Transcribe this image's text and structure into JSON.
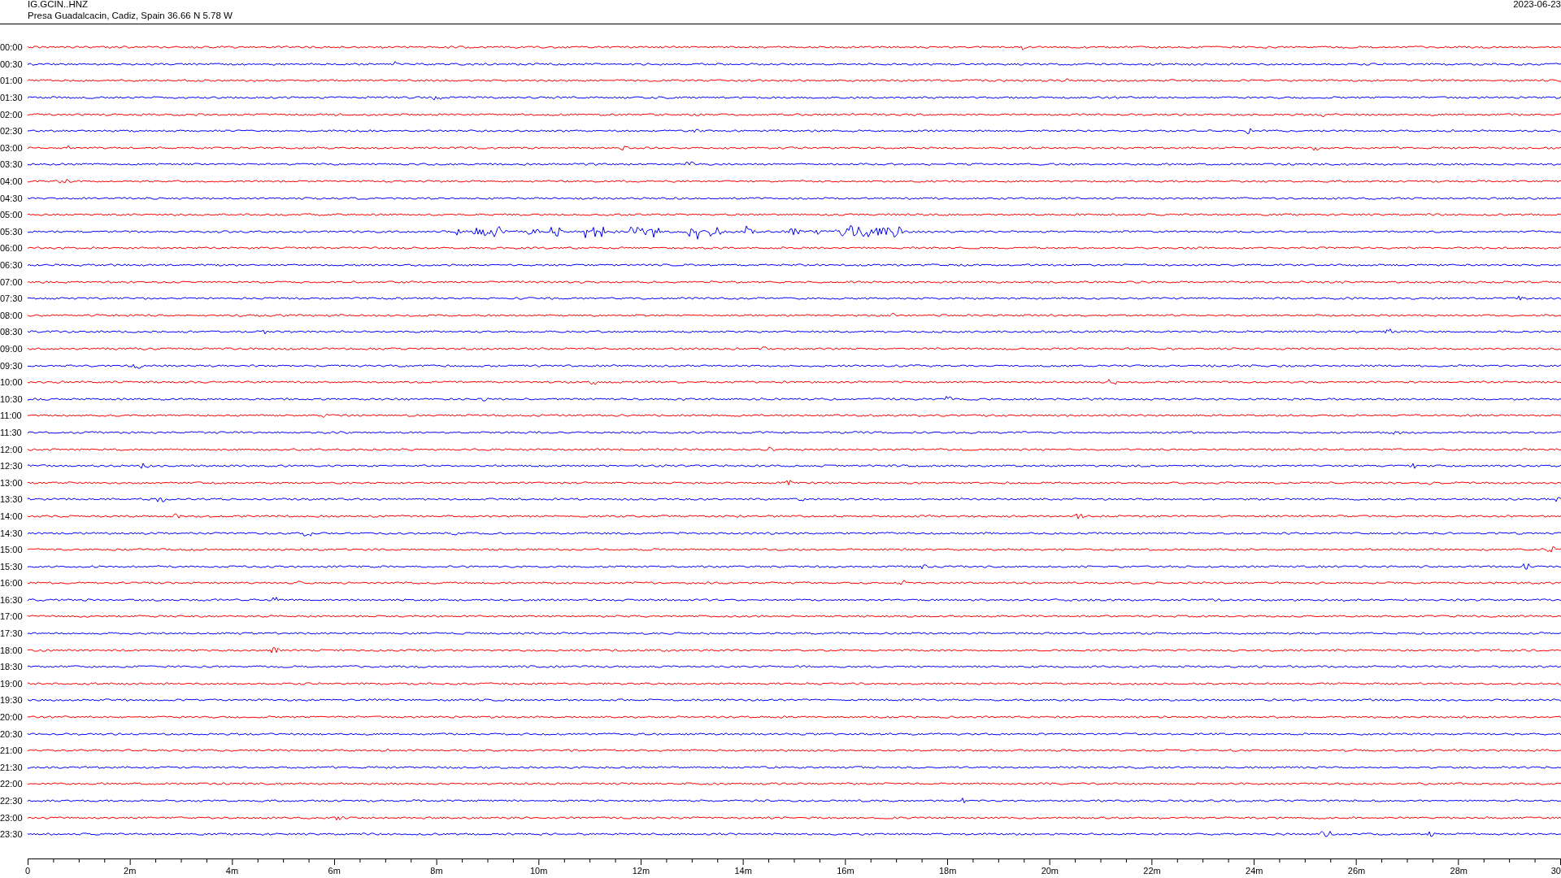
{
  "header": {
    "station": "IG.GCIN..HNZ",
    "location": "Presa Guadalcacin, Cadiz, Spain  36.66 N 5.78 W",
    "date": "2023-06-23"
  },
  "traces": [
    {
      "time": "00:00",
      "color": "#ff0000",
      "kind": "quiet"
    },
    {
      "time": "00:30",
      "color": "#0000ff",
      "kind": "quiet"
    },
    {
      "time": "01:00",
      "color": "#ff0000",
      "kind": "quiet"
    },
    {
      "time": "01:30",
      "color": "#0000ff",
      "kind": "quiet"
    },
    {
      "time": "02:00",
      "color": "#ff0000",
      "kind": "quiet"
    },
    {
      "time": "02:30",
      "color": "#0000ff",
      "kind": "quiet"
    },
    {
      "time": "03:00",
      "color": "#ff0000",
      "kind": "quiet"
    },
    {
      "time": "03:30",
      "color": "#0000ff",
      "kind": "quiet"
    },
    {
      "time": "04:00",
      "color": "#ff0000",
      "kind": "quiet"
    },
    {
      "time": "04:30",
      "color": "#0000ff",
      "kind": "quiet"
    },
    {
      "time": "05:00",
      "color": "#ff0000",
      "kind": "quiet"
    },
    {
      "time": "05:30",
      "color": "#0000ff",
      "kind": "event"
    },
    {
      "time": "06:00",
      "color": "#ff0000",
      "kind": "quiet"
    },
    {
      "time": "06:30",
      "color": "#0000ff",
      "kind": "quiet"
    },
    {
      "time": "07:00",
      "color": "#ff0000",
      "kind": "quiet"
    },
    {
      "time": "07:30",
      "color": "#0000ff",
      "kind": "quiet"
    },
    {
      "time": "08:00",
      "color": "#ff0000",
      "kind": "quiet"
    },
    {
      "time": "08:30",
      "color": "#0000ff",
      "kind": "quiet"
    },
    {
      "time": "09:00",
      "color": "#ff0000",
      "kind": "quiet"
    },
    {
      "time": "09:30",
      "color": "#0000ff",
      "kind": "quiet"
    },
    {
      "time": "10:00",
      "color": "#ff0000",
      "kind": "quiet"
    },
    {
      "time": "10:30",
      "color": "#0000ff",
      "kind": "quiet"
    },
    {
      "time": "11:00",
      "color": "#ff0000",
      "kind": "quiet"
    },
    {
      "time": "11:30",
      "color": "#0000ff",
      "kind": "quiet"
    },
    {
      "time": "12:00",
      "color": "#ff0000",
      "kind": "quiet"
    },
    {
      "time": "12:30",
      "color": "#0000ff",
      "kind": "quiet"
    },
    {
      "time": "13:00",
      "color": "#ff0000",
      "kind": "quiet"
    },
    {
      "time": "13:30",
      "color": "#0000ff",
      "kind": "quiet"
    },
    {
      "time": "14:00",
      "color": "#ff0000",
      "kind": "quiet"
    },
    {
      "time": "14:30",
      "color": "#0000ff",
      "kind": "quiet"
    },
    {
      "time": "15:00",
      "color": "#ff0000",
      "kind": "quiet"
    },
    {
      "time": "15:30",
      "color": "#0000ff",
      "kind": "quiet"
    },
    {
      "time": "16:00",
      "color": "#ff0000",
      "kind": "quiet"
    },
    {
      "time": "16:30",
      "color": "#0000ff",
      "kind": "quiet"
    },
    {
      "time": "17:00",
      "color": "#ff0000",
      "kind": "quiet"
    },
    {
      "time": "17:30",
      "color": "#0000ff",
      "kind": "quiet"
    },
    {
      "time": "18:00",
      "color": "#ff0000",
      "kind": "quiet"
    },
    {
      "time": "18:30",
      "color": "#0000ff",
      "kind": "quiet"
    },
    {
      "time": "19:00",
      "color": "#ff0000",
      "kind": "quiet"
    },
    {
      "time": "19:30",
      "color": "#0000ff",
      "kind": "quiet"
    },
    {
      "time": "20:00",
      "color": "#ff0000",
      "kind": "quiet"
    },
    {
      "time": "20:30",
      "color": "#0000ff",
      "kind": "quiet"
    },
    {
      "time": "21:00",
      "color": "#ff0000",
      "kind": "quiet"
    },
    {
      "time": "21:30",
      "color": "#0000ff",
      "kind": "quiet"
    },
    {
      "time": "22:00",
      "color": "#ff0000",
      "kind": "quiet"
    },
    {
      "time": "22:30",
      "color": "#0000ff",
      "kind": "quiet"
    },
    {
      "time": "23:00",
      "color": "#ff0000",
      "kind": "quiet"
    },
    {
      "time": "23:30",
      "color": "#0000ff",
      "kind": "quiet"
    }
  ],
  "axis": {
    "labels": [
      "0",
      "2m",
      "4m",
      "6m",
      "8m",
      "10m",
      "12m",
      "14m",
      "16m",
      "18m",
      "20m",
      "22m",
      "24m",
      "26m",
      "28m",
      "30"
    ]
  }
}
